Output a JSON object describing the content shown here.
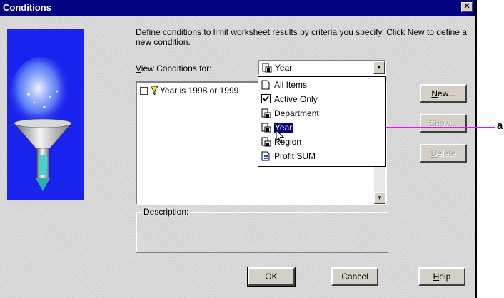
{
  "window": {
    "title": "Conditions",
    "close_glyph": "✕"
  },
  "intro_text": "Define conditions to limit worksheet results by criteria you specify. Click New to define a new condition.",
  "view_conditions": {
    "label_accel": "V",
    "label_rest": "iew Conditions for:",
    "selected": "Year",
    "selected_icon": "folder-item-icon"
  },
  "conditions_list": [
    {
      "label": "Year is 1998 or 1999",
      "checked": false,
      "icon": "funnel-icon"
    }
  ],
  "dropdown_options": [
    {
      "label": "All Items",
      "icon": "document-icon"
    },
    {
      "label": "Active Only",
      "icon": "checkbox-checked-icon"
    },
    {
      "label": "Department",
      "icon": "folder-item-icon"
    },
    {
      "label": "Year",
      "icon": "folder-item-icon",
      "highlighted": true
    },
    {
      "label": "Region",
      "icon": "folder-item-icon"
    },
    {
      "label": "Profit SUM",
      "icon": "calculation-icon"
    }
  ],
  "buttons": {
    "new": {
      "accel": "N",
      "rest": "ew...",
      "enabled": true
    },
    "show": {
      "accel": "",
      "rest": "Show...",
      "enabled": false
    },
    "delete": {
      "accel": "D",
      "rest": "elete",
      "enabled": false
    },
    "ok": {
      "label": "OK"
    },
    "cancel": {
      "label": "Cancel"
    },
    "help": {
      "accel": "H",
      "rest": "elp"
    }
  },
  "description_label": "Description:",
  "callout_label": "a",
  "colors": {
    "title_bar": "#000080",
    "callout": "#ff00ff",
    "art_blue": "#1a22ee"
  }
}
